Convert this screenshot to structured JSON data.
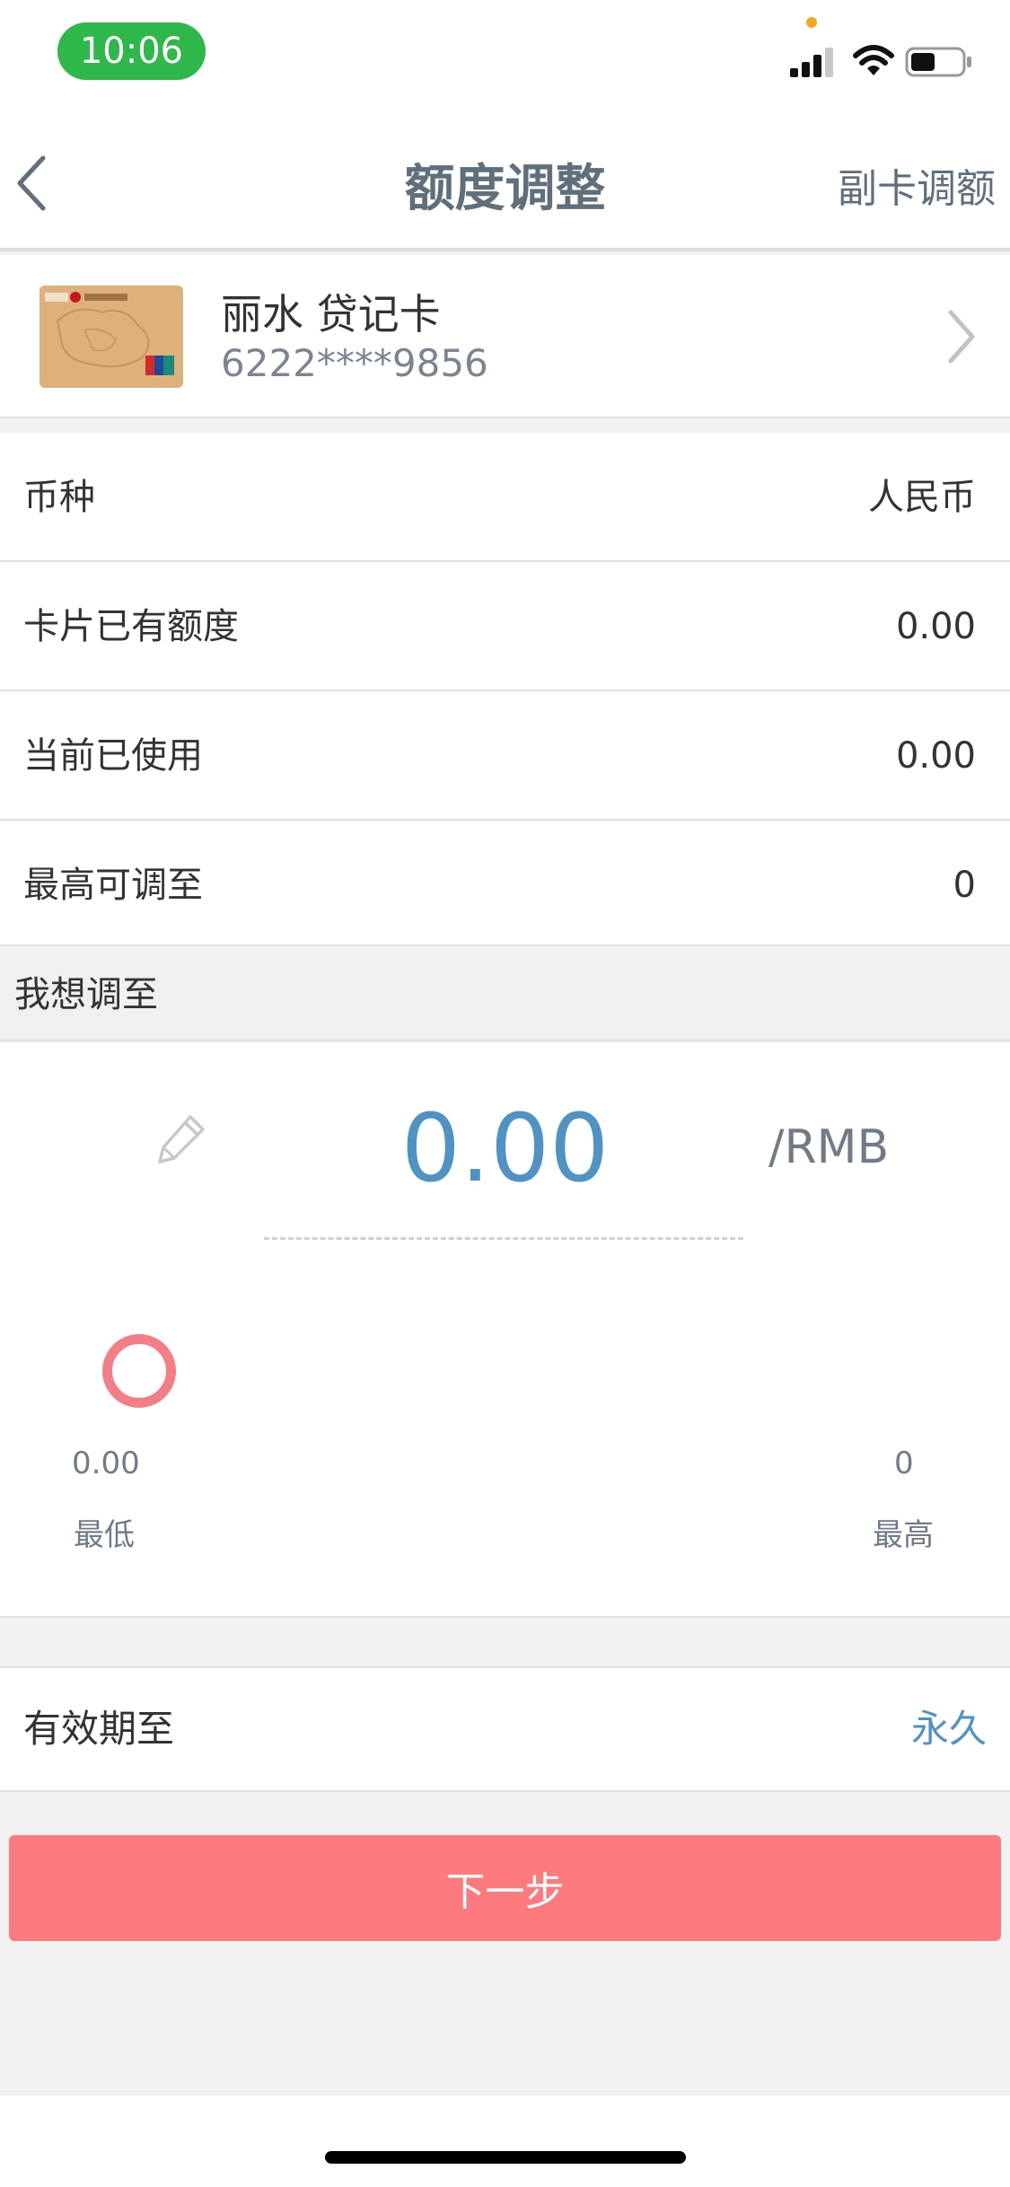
{
  "status_bar": {
    "time": "10:06",
    "icons": [
      "signal-icon",
      "wifi-icon",
      "battery-icon"
    ],
    "pill_color": "#2fb84a"
  },
  "nav": {
    "title": "额度调整",
    "right_action": "副卡调额",
    "back_icon": "chevron-left-icon"
  },
  "card": {
    "name": "丽水 贷记卡",
    "number": "6222****9856"
  },
  "info_rows": [
    {
      "label": "币种",
      "value": "人民币"
    },
    {
      "label": "卡片已有额度",
      "value": "0.00"
    },
    {
      "label": "当前已使用",
      "value": "0.00"
    },
    {
      "label": "最高可调至",
      "value": "0"
    }
  ],
  "adjust": {
    "section_label": "我想调至",
    "amount": "0.00",
    "currency": "/RMB",
    "min_value": "0.00",
    "min_label": "最低",
    "max_value": "0",
    "max_label": "最高",
    "slider_level": 0
  },
  "validity": {
    "label": "有效期至",
    "value": "永久"
  },
  "next_button": "下一步",
  "colors": {
    "accent_blue": "#4f93c4",
    "button_red": "#fd7b7e",
    "slider_ring": "#f47e85"
  }
}
